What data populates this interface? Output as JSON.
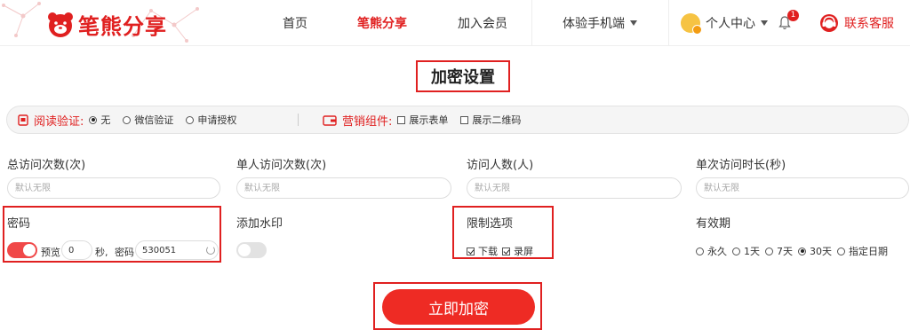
{
  "header": {
    "brand": "笔熊分享",
    "nav": {
      "home": "首页",
      "share": "笔熊分享",
      "member": "加入会员",
      "mobile": "体验手机端"
    },
    "user_center": "个人中心",
    "notification_count": "1",
    "service": "联系客服",
    "accent_color": "#e02020"
  },
  "title": "加密设置",
  "read_verify": {
    "label": "阅读验证:",
    "options": [
      "无",
      "微信验证",
      "申请授权"
    ],
    "selected": "无"
  },
  "marketing": {
    "label": "营销组件:",
    "options": [
      "展示表单",
      "展示二维码"
    ],
    "checked": []
  },
  "fields": {
    "total_visits": {
      "label": "总访问次数(次)",
      "placeholder": "默认无限"
    },
    "single_visits": {
      "label": "单人访问次数(次)",
      "placeholder": "默认无限"
    },
    "visitors": {
      "label": "访问人数(人)",
      "placeholder": "默认无限"
    },
    "duration": {
      "label": "单次访问时长(秒)",
      "placeholder": "默认无限"
    }
  },
  "password": {
    "label": "密码",
    "enabled": true,
    "preview_label": "预览",
    "preview_seconds": "0",
    "seconds_unit": "秒,",
    "password_label": "密码",
    "password_value": "530051"
  },
  "watermark": {
    "label": "添加水印",
    "enabled": false
  },
  "limits": {
    "label": "限制选项",
    "options": [
      "下载",
      "录屏"
    ],
    "checked": [
      "下载",
      "录屏"
    ]
  },
  "validity": {
    "label": "有效期",
    "options": [
      "永久",
      "1天",
      "7天",
      "30天",
      "指定日期"
    ],
    "selected": "30天"
  },
  "submit": "立即加密"
}
